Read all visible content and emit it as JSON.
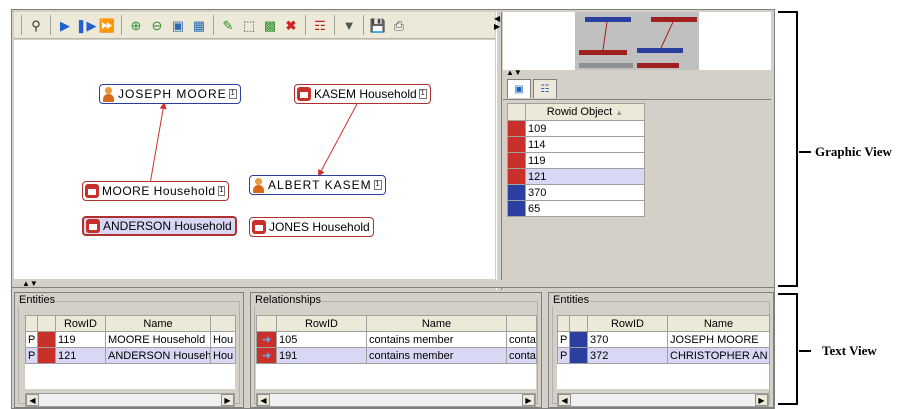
{
  "toolbar": {
    "icons": [
      "search-person-icon",
      "play-icon",
      "step-icon",
      "fast-forward-icon",
      "zoom-in-icon",
      "zoom-out-icon",
      "fit-icon",
      "layout-icon",
      "edit-icon",
      "select-icon",
      "select-all-icon",
      "delete-icon",
      "hierarchy-icon",
      "filter-icon",
      "save-icon",
      "print-icon"
    ]
  },
  "graph": {
    "nodes": [
      {
        "label": "JOSEPH MOORE",
        "type": "person",
        "count": "1"
      },
      {
        "label": "KASEM Household",
        "type": "household",
        "count": "1"
      },
      {
        "label": "MOORE Household",
        "type": "household",
        "count": "1"
      },
      {
        "label": "ALBERT KASEM",
        "type": "person",
        "count": "1"
      },
      {
        "label": "ANDERSON Household",
        "type": "household",
        "count": ""
      },
      {
        "label": "JONES Household",
        "type": "household",
        "count": ""
      }
    ]
  },
  "rowid_table": {
    "header": "Rowid Object",
    "rows": [
      {
        "value": "109",
        "type": "household"
      },
      {
        "value": "114",
        "type": "household"
      },
      {
        "value": "119",
        "type": "household"
      },
      {
        "value": "121",
        "type": "household",
        "selected": true
      },
      {
        "value": "370",
        "type": "person"
      },
      {
        "value": "65",
        "type": "person"
      }
    ]
  },
  "entities_left": {
    "title": "Entities",
    "columns": [
      "",
      "",
      "RowID",
      "Name",
      ""
    ],
    "rows": [
      {
        "flag": "P",
        "rowid": "119",
        "name": "MOORE Household",
        "extra": "Hou"
      },
      {
        "flag": "P",
        "rowid": "121",
        "name": "ANDERSON Househ...",
        "extra": "Hou",
        "selected": true
      }
    ]
  },
  "relationships": {
    "title": "Relationships",
    "columns": [
      "",
      "RowID",
      "Name",
      ""
    ],
    "rows": [
      {
        "rowid": "105",
        "name": "contains member",
        "extra": "contai"
      },
      {
        "rowid": "191",
        "name": "contains member",
        "extra": "contai",
        "selected": true
      }
    ]
  },
  "entities_right": {
    "title": "Entities",
    "columns": [
      "",
      "",
      "RowID",
      "Name"
    ],
    "rows": [
      {
        "flag": "P",
        "rowid": "370",
        "name": "JOSEPH MOORE"
      },
      {
        "flag": "P",
        "rowid": "372",
        "name": "CHRISTOPHER AN",
        "selected": true
      }
    ]
  },
  "annotations": {
    "graphic_view": "Graphic View",
    "text_view": "Text View"
  }
}
